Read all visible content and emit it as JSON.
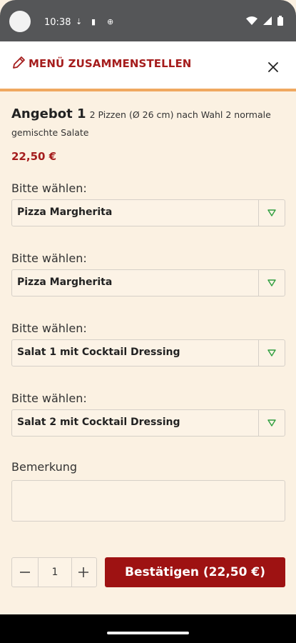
{
  "status_bar": {
    "time": "10:38",
    "icons": [
      "download-icon",
      "sd-card-icon",
      "vpn-icon",
      "wifi-icon",
      "signal-icon",
      "battery-icon"
    ]
  },
  "header": {
    "title": "MENÜ ZUSAMMENSTELLEN",
    "icon": "pencil-icon",
    "close_icon": "close-icon",
    "accent_color": "#a51d1d"
  },
  "offer": {
    "name": "Angebot 1",
    "description": "2 Pizzen (Ø 26 cm) nach Wahl 2 normale gemischte Salate",
    "price": "22,50 €"
  },
  "selects": [
    {
      "label": "Bitte wählen:",
      "value": "Pizza Margherita"
    },
    {
      "label": "Bitte wählen:",
      "value": "Pizza Margherita"
    },
    {
      "label": "Bitte wählen:",
      "value": "Salat 1 mit Cocktail Dressing"
    },
    {
      "label": "Bitte wählen:",
      "value": "Salat 2 mit Cocktail Dressing"
    }
  ],
  "remark": {
    "label": "Bemerkung",
    "value": ""
  },
  "quantity": {
    "value": "1",
    "minus_icon": "minus-icon",
    "plus_icon": "plus-icon"
  },
  "confirm": {
    "label": "Bestätigen (22,50 €)",
    "color": "#9e1212"
  }
}
